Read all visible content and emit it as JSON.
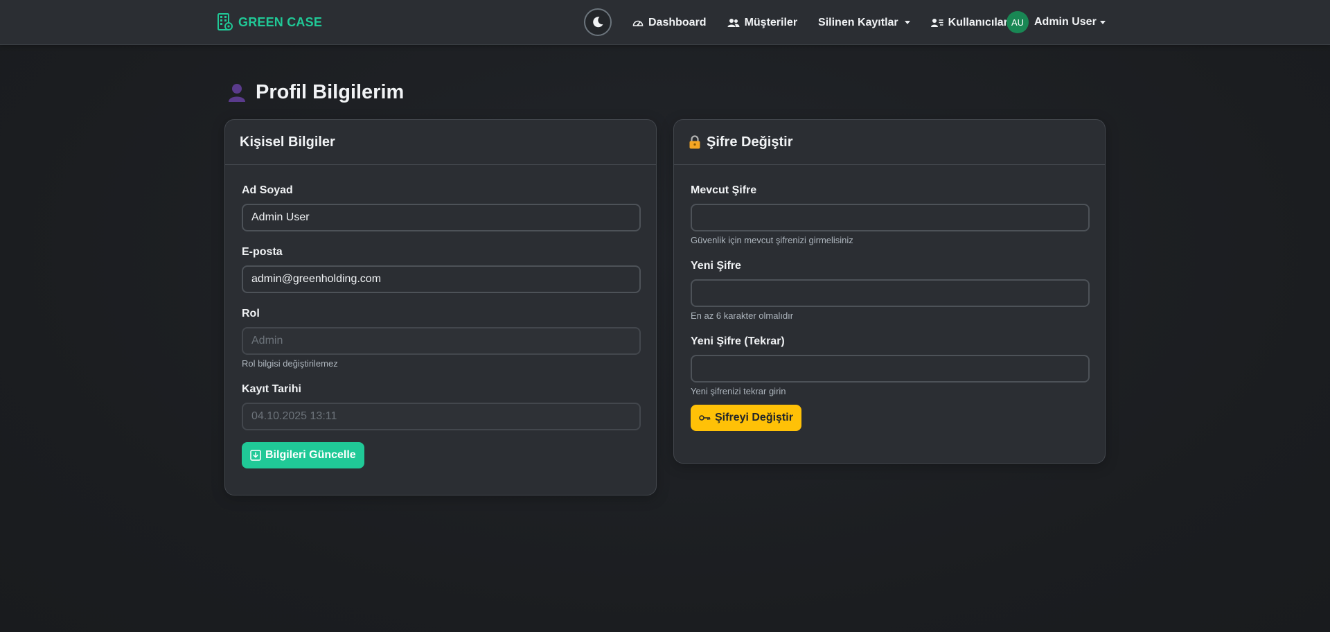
{
  "navbar": {
    "brand": "GREEN CASE",
    "brand_color": "#20c997",
    "theme_toggle_icon": "moon-icon",
    "items": [
      {
        "label": "Dashboard",
        "icon": "speedometer-icon"
      },
      {
        "label": "Müşteriler",
        "icon": "people-icon"
      },
      {
        "label": "Silinen Kayıtlar",
        "icon": "",
        "dropdown": true
      },
      {
        "label": "Kullanıcılar",
        "icon": "person-lines-icon"
      }
    ],
    "user": {
      "initials": "AU",
      "name": "Admin User",
      "avatar_color": "#198754"
    }
  },
  "page": {
    "title": "Profil Bilgilerim",
    "title_icon": "bust-silhouette-icon"
  },
  "personal": {
    "header": "Kişisel Bilgiler",
    "name_label": "Ad Soyad",
    "name_value": "Admin User",
    "email_label": "E-posta",
    "email_value": "admin@greenholding.com",
    "role_label": "Rol",
    "role_value": "Admin",
    "role_hint": "Rol bilgisi değiştirilemez",
    "date_label": "Kayıt Tarihi",
    "date_value": "04.10.2025 13:11",
    "update_button": "Bilgileri Güncelle",
    "update_color": "#20c997"
  },
  "password": {
    "header": "Şifre Değiştir",
    "header_icon": "lock-icon",
    "current_label": "Mevcut Şifre",
    "current_value": "",
    "current_hint": "Güvenlik için mevcut şifrenizi girmelisiniz",
    "new_label": "Yeni Şifre",
    "new_value": "",
    "new_hint": "En az 6 karakter olmalıdır",
    "confirm_label": "Yeni Şifre (Tekrar)",
    "confirm_value": "",
    "confirm_hint": "Yeni şifrenizi tekrar girin",
    "change_button": "Şifreyi Değiştir",
    "change_color": "#ffc107"
  }
}
